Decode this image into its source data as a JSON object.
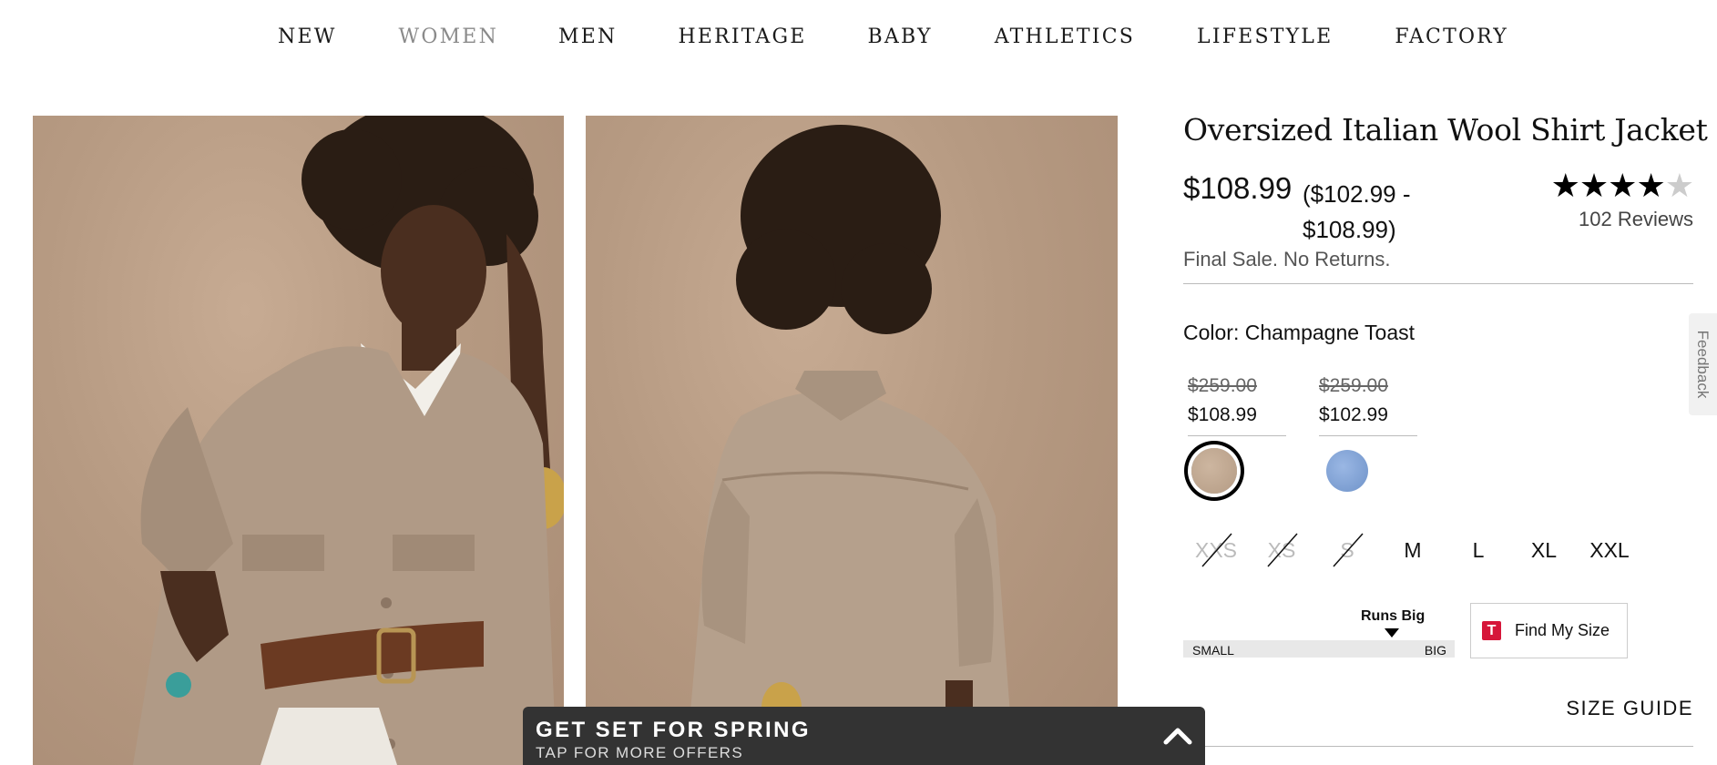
{
  "nav": {
    "items": [
      "NEW",
      "WOMEN",
      "MEN",
      "HERITAGE",
      "BABY",
      "ATHLETICS",
      "LIFESTYLE",
      "FACTORY"
    ],
    "active": "WOMEN"
  },
  "product": {
    "title": "Oversized Italian Wool Shirt Jacket",
    "price": "$108.99",
    "price_range": "($102.99 - $108.99)",
    "rating": 4.5,
    "rating_max": 5,
    "reviews": "102 Reviews",
    "final_sale": "Final Sale. No Returns.",
    "color_label": "Color: Champagne Toast",
    "variants": [
      {
        "old_price": "$259.00",
        "new_price": "$108.99",
        "swatch_color": "#c2a991",
        "selected": true
      },
      {
        "old_price": "$259.00",
        "new_price": "$102.99",
        "swatch_color": "#86a6d8",
        "selected": false
      }
    ],
    "sizes": [
      {
        "label": "XXS",
        "available": false
      },
      {
        "label": "XS",
        "available": false
      },
      {
        "label": "S",
        "available": false
      },
      {
        "label": "M",
        "available": true
      },
      {
        "label": "L",
        "available": true
      },
      {
        "label": "XL",
        "available": true
      },
      {
        "label": "XXL",
        "available": true
      }
    ],
    "fit": {
      "label": "Runs Big",
      "left": "SMALL",
      "right": "BIG",
      "level": 0.77
    },
    "find_my_size": "Find My Size",
    "size_guide": "SIZE GUIDE"
  },
  "feedback": "Feedback",
  "promo": {
    "title": "GET SET FOR SPRING",
    "subtitle": "TAP FOR MORE OFFERS"
  },
  "colors": {
    "backdrop": "#b69a82",
    "jacket": "#b09a86",
    "promo_bg": "#333333",
    "find_size_logo": "#d6163a"
  }
}
